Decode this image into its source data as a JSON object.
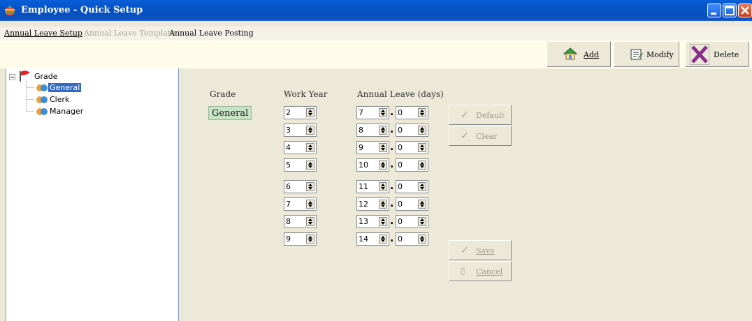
{
  "window": {
    "title": "Employee - Quick Setup"
  },
  "menu": {
    "items": [
      {
        "label": "Annual Leave Setup"
      },
      {
        "label": "Annual Leave Template"
      },
      {
        "label": "Annual Leave Posting"
      }
    ]
  },
  "toolbar": {
    "add_label": "Add",
    "modify_label": "Modify",
    "delete_label": "Delete"
  },
  "tree": {
    "root": "Grade",
    "children": [
      "General",
      "Clerk",
      "Manager"
    ],
    "selected": "General"
  },
  "form": {
    "headers": {
      "grade": "Grade",
      "work_year": "Work Year",
      "annual_leave": "Annual Leave (days)"
    },
    "grade_value": "General",
    "rows": [
      {
        "work_year": "2",
        "leave_days": "7",
        "leave_fraction": "0"
      },
      {
        "work_year": "3",
        "leave_days": "8",
        "leave_fraction": "0"
      },
      {
        "work_year": "4",
        "leave_days": "9",
        "leave_fraction": "0"
      },
      {
        "work_year": "5",
        "leave_days": "10",
        "leave_fraction": "0"
      },
      {
        "work_year": "6",
        "leave_days": "11",
        "leave_fraction": "0"
      },
      {
        "work_year": "7",
        "leave_days": "12",
        "leave_fraction": "0"
      },
      {
        "work_year": "8",
        "leave_days": "13",
        "leave_fraction": "0"
      },
      {
        "work_year": "9",
        "leave_days": "14",
        "leave_fraction": "0"
      }
    ],
    "separator": "."
  },
  "actions": {
    "default_label": "Default",
    "clear_label": "Clear",
    "save_label": "Save",
    "cancel_label": "Cancel"
  }
}
